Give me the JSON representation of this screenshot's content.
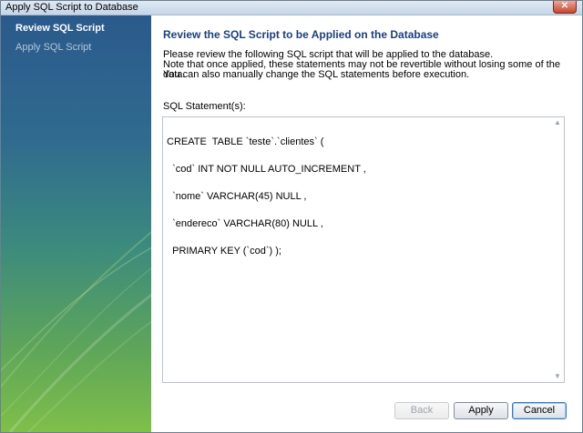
{
  "window": {
    "title": "Apply SQL Script to Database"
  },
  "sidebar": {
    "items": [
      {
        "label": "Review SQL Script",
        "active": true
      },
      {
        "label": "Apply SQL Script",
        "active": false
      }
    ]
  },
  "main": {
    "heading": "Review the SQL Script to be Applied on the Database",
    "description": [
      "Please review the following SQL script that will be applied to the database.",
      "Note that once applied, these statements may not be revertible without losing some of the data.",
      "You can also manually change the SQL statements before execution."
    ],
    "statements_label": "SQL Statement(s):",
    "sql_lines": [
      "CREATE  TABLE `teste`.`clientes` (",
      "  `cod` INT NOT NULL AUTO_INCREMENT ,",
      "  `nome` VARCHAR(45) NULL ,",
      "  `endereco` VARCHAR(80) NULL ,",
      "  PRIMARY KEY (`cod`) );"
    ]
  },
  "buttons": {
    "back": "Back",
    "apply": "Apply",
    "cancel": "Cancel"
  },
  "icons": {
    "close": "close-icon",
    "scroll_up": "scroll-up-arrow-icon",
    "scroll_down": "scroll-down-arrow-icon"
  }
}
